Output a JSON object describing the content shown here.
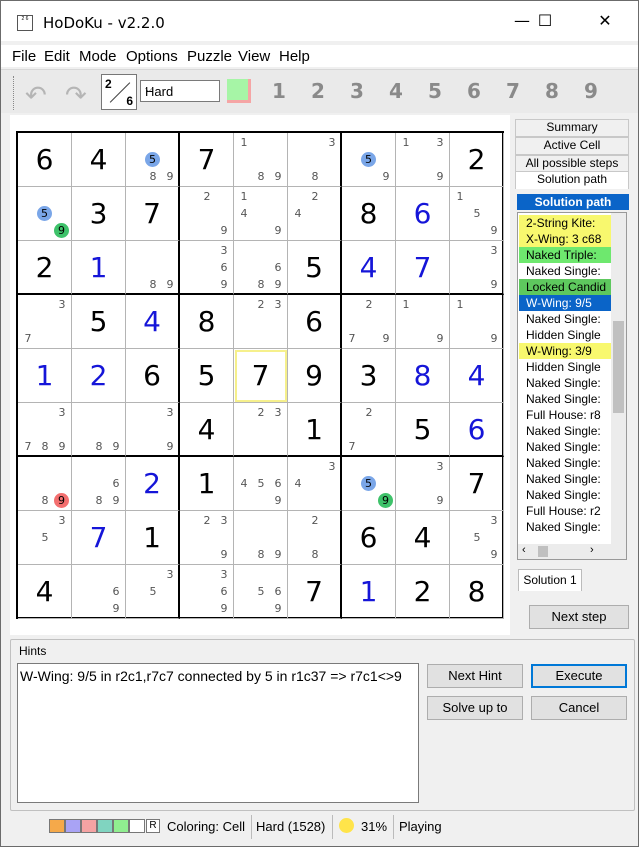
{
  "window": {
    "title": "HoDoKu - v2.2.0",
    "minimize_glyph": "—",
    "maximize_glyph": "☐",
    "close_glyph": "✕",
    "app_icon_text": "2 6"
  },
  "menu": [
    "File",
    "Edit",
    "Mode",
    "Options",
    "Puzzle",
    "View",
    "Help"
  ],
  "toolbar": {
    "mode_icon_a": "2",
    "mode_icon_b": "6",
    "level_value": "Hard",
    "level_arrow": "⌵",
    "digits": [
      "1",
      "2",
      "3",
      "4",
      "5",
      "6",
      "7",
      "8",
      "9"
    ],
    "undo_glyph": "↶",
    "redo_glyph": "↷",
    "color_swatch": "#a6f5a6"
  },
  "board": {
    "selected_cell": "r6c5",
    "rows": [
      [
        {
          "v": "6"
        },
        {
          "v": "4"
        },
        {
          "c": [
            "5b",
            "8",
            "9"
          ]
        },
        {
          "v": "7"
        },
        {
          "c": [
            "1",
            "8",
            "9"
          ]
        },
        {
          "c": [
            "3",
            "8"
          ]
        },
        {
          "c": [
            "5b",
            "9"
          ]
        },
        {
          "c": [
            "1",
            "3",
            "9"
          ]
        },
        {
          "v": "2"
        }
      ],
      [
        {
          "c": [
            "5b",
            "9g"
          ]
        },
        {
          "v": "3"
        },
        {
          "v": "7"
        },
        {
          "c": [
            "2",
            "9"
          ]
        },
        {
          "c": [
            "1",
            "4",
            "9"
          ]
        },
        {
          "c": [
            "2",
            "4"
          ]
        },
        {
          "v": "8"
        },
        {
          "v": "6",
          "u": true
        },
        {
          "c": [
            "1",
            "5",
            "9"
          ]
        }
      ],
      [
        {
          "v": "2"
        },
        {
          "v": "1",
          "u": true
        },
        {
          "c": [
            "8",
            "9"
          ]
        },
        {
          "c": [
            "3",
            "6",
            "9"
          ]
        },
        {
          "c": [
            "6",
            "8",
            "9"
          ]
        },
        {
          "v": "5"
        },
        {
          "v": "4",
          "u": true
        },
        {
          "v": "7",
          "u": true
        },
        {
          "c": [
            "3",
            "9"
          ]
        }
      ],
      [
        {
          "c": [
            "3",
            "7"
          ]
        },
        {
          "v": "5"
        },
        {
          "v": "4",
          "u": true
        },
        {
          "v": "8"
        },
        {
          "c": [
            "2",
            "3"
          ]
        },
        {
          "v": "6"
        },
        {
          "c": [
            "2",
            "7",
            "9"
          ]
        },
        {
          "c": [
            "1",
            "9"
          ]
        },
        {
          "c": [
            "1",
            "9"
          ]
        }
      ],
      [
        {
          "v": "1",
          "u": true
        },
        {
          "v": "2",
          "u": true
        },
        {
          "v": "6"
        },
        {
          "v": "5"
        },
        {
          "v": "7",
          "sel": true
        },
        {
          "v": "9"
        },
        {
          "v": "3"
        },
        {
          "v": "8",
          "u": true
        },
        {
          "v": "4",
          "u": true
        }
      ],
      [
        {
          "c": [
            "3",
            "7",
            "8",
            "9"
          ]
        },
        {
          "c": [
            "8",
            "9"
          ]
        },
        {
          "c": [
            "3",
            "9"
          ]
        },
        {
          "v": "4"
        },
        {
          "c": [
            "2",
            "3"
          ]
        },
        {
          "v": "1"
        },
        {
          "c": [
            "2",
            "7"
          ]
        },
        {
          "v": "5"
        },
        {
          "v": "6",
          "u": true
        }
      ],
      [
        {
          "c": [
            "8",
            "9r"
          ]
        },
        {
          "c": [
            "6",
            "8",
            "9"
          ]
        },
        {
          "v": "2",
          "u": true
        },
        {
          "v": "1"
        },
        {
          "c": [
            "4",
            "5",
            "6",
            "9"
          ]
        },
        {
          "c": [
            "3",
            "4"
          ]
        },
        {
          "c": [
            "5b",
            "9g"
          ]
        },
        {
          "c": [
            "3",
            "9"
          ]
        },
        {
          "v": "7"
        }
      ],
      [
        {
          "c": [
            "3",
            "5"
          ]
        },
        {
          "v": "7",
          "u": true
        },
        {
          "v": "1"
        },
        {
          "c": [
            "2",
            "3",
            "9"
          ]
        },
        {
          "c": [
            "8",
            "9"
          ]
        },
        {
          "c": [
            "2",
            "8"
          ]
        },
        {
          "v": "6"
        },
        {
          "v": "4"
        },
        {
          "c": [
            "3",
            "5",
            "9"
          ]
        }
      ],
      [
        {
          "v": "4"
        },
        {
          "c": [
            "6",
            "9"
          ]
        },
        {
          "c": [
            "3",
            "5"
          ]
        },
        {
          "c": [
            "3",
            "6",
            "9"
          ]
        },
        {
          "c": [
            "5",
            "6",
            "9"
          ]
        },
        {
          "v": "7"
        },
        {
          "v": "1",
          "u": true
        },
        {
          "v": "2"
        },
        {
          "v": "8"
        }
      ]
    ]
  },
  "right_panel": {
    "tabs": [
      "Summary",
      "Active Cell",
      "All possible steps",
      "Solution path"
    ],
    "header": "Solution path",
    "steps": [
      {
        "text": "2-String Kite:",
        "bg": "#f8f86e"
      },
      {
        "text": "X-Wing: 3 c68",
        "bg": "#f8f86e"
      },
      {
        "text": "Naked Triple:",
        "bg": "#6ee86e"
      },
      {
        "text": "Naked Single:",
        "bg": "#ffffff"
      },
      {
        "text": "Locked Candid",
        "bg": "#5ec85e"
      },
      {
        "text": "W-Wing: 9/5",
        "bg": "#0a64c8",
        "color": "#ffffff"
      },
      {
        "text": "Naked Single:",
        "bg": "#ffffff"
      },
      {
        "text": "Hidden Single",
        "bg": "#ffffff"
      },
      {
        "text": "W-Wing: 3/9",
        "bg": "#f8f86e"
      },
      {
        "text": "Hidden Single",
        "bg": "#ffffff"
      },
      {
        "text": "Naked Single:",
        "bg": "#ffffff"
      },
      {
        "text": "Naked Single:",
        "bg": "#ffffff"
      },
      {
        "text": "Full House: r8",
        "bg": "#ffffff"
      },
      {
        "text": "Naked Single:",
        "bg": "#ffffff"
      },
      {
        "text": "Naked Single:",
        "bg": "#ffffff"
      },
      {
        "text": "Naked Single:",
        "bg": "#ffffff"
      },
      {
        "text": "Naked Single:",
        "bg": "#ffffff"
      },
      {
        "text": "Naked Single:",
        "bg": "#ffffff"
      },
      {
        "text": "Full House: r2",
        "bg": "#ffffff"
      },
      {
        "text": "Naked Single:",
        "bg": "#ffffff"
      }
    ],
    "scroll_left": "‹",
    "scroll_right": "›",
    "solution_tab": "Solution 1",
    "next_step": "Next step"
  },
  "hints": {
    "label": "Hints",
    "text": "W-Wing: 9/5 in r2c1,r7c7 connected by 5 in r1c37 => r7c1<>9",
    "next_hint": "Next Hint",
    "execute": "Execute",
    "solve_up_to": "Solve up to",
    "cancel": "Cancel"
  },
  "status": {
    "colors": [
      "#f5a94a",
      "#a9a3f5",
      "#f5a3a3",
      "#80d4c0",
      "#90ee90",
      "#ffffff"
    ],
    "reset_label": "R",
    "coloring": "Coloring: Cell",
    "difficulty": "Hard (1528)",
    "progress": "31%",
    "state": "Playing"
  }
}
